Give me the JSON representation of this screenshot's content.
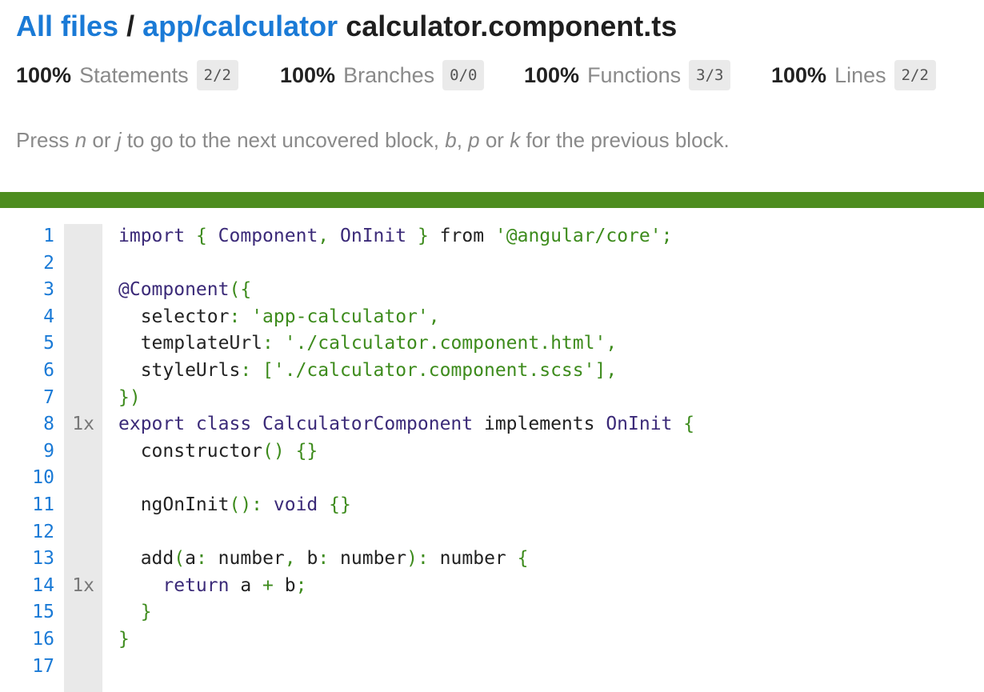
{
  "breadcrumb": {
    "all_files": "All files",
    "separator": "/",
    "folder": "app/calculator",
    "file": "calculator.component.ts"
  },
  "stats": [
    {
      "pct": "100%",
      "name": "Statements",
      "frac": "2/2"
    },
    {
      "pct": "100%",
      "name": "Branches",
      "frac": "0/0"
    },
    {
      "pct": "100%",
      "name": "Functions",
      "frac": "3/3"
    },
    {
      "pct": "100%",
      "name": "Lines",
      "frac": "2/2"
    }
  ],
  "hint": {
    "t1": "Press ",
    "k1": "n",
    "t2": " or ",
    "k2": "j",
    "t3": " to go to the next uncovered block, ",
    "k3": "b",
    "t4": ", ",
    "k4": "p",
    "t5": " or ",
    "k5": "k",
    "t6": " for the previous block."
  },
  "colors": {
    "status_bar": "#4d8d1f",
    "link": "#1a7ad6",
    "gutter": "#e9e9e9"
  },
  "code": {
    "lines": [
      {
        "n": "1",
        "hits": "",
        "tokens": [
          [
            "kw",
            "import"
          ],
          [
            "tx",
            " "
          ],
          [
            "pn",
            "{"
          ],
          [
            "tx",
            " "
          ],
          [
            "ty",
            "Component"
          ],
          [
            "pn",
            ","
          ],
          [
            "tx",
            " "
          ],
          [
            "ty",
            "OnInit"
          ],
          [
            "tx",
            " "
          ],
          [
            "pn",
            "}"
          ],
          [
            "tx",
            " from "
          ],
          [
            "str",
            "'@angular/core'"
          ],
          [
            "pn",
            ";"
          ]
        ]
      },
      {
        "n": "2",
        "hits": "",
        "tokens": []
      },
      {
        "n": "3",
        "hits": "",
        "tokens": [
          [
            "kw",
            "@Component"
          ],
          [
            "pn",
            "({"
          ]
        ]
      },
      {
        "n": "4",
        "hits": "",
        "tokens": [
          [
            "tx",
            "  selector"
          ],
          [
            "pn",
            ":"
          ],
          [
            "tx",
            " "
          ],
          [
            "str",
            "'app-calculator'"
          ],
          [
            "pn",
            ","
          ]
        ]
      },
      {
        "n": "5",
        "hits": "",
        "tokens": [
          [
            "tx",
            "  templateUrl"
          ],
          [
            "pn",
            ":"
          ],
          [
            "tx",
            " "
          ],
          [
            "str",
            "'./calculator.component.html'"
          ],
          [
            "pn",
            ","
          ]
        ]
      },
      {
        "n": "6",
        "hits": "",
        "tokens": [
          [
            "tx",
            "  styleUrls"
          ],
          [
            "pn",
            ":"
          ],
          [
            "tx",
            " "
          ],
          [
            "str",
            "['./calculator.component.scss']"
          ],
          [
            "pn",
            ","
          ]
        ]
      },
      {
        "n": "7",
        "hits": "",
        "tokens": [
          [
            "pn",
            "})"
          ]
        ]
      },
      {
        "n": "8",
        "hits": "1x",
        "tokens": [
          [
            "kw",
            "export class"
          ],
          [
            "tx",
            " "
          ],
          [
            "ty",
            "CalculatorComponent"
          ],
          [
            "tx",
            " implements "
          ],
          [
            "ty",
            "OnInit"
          ],
          [
            "tx",
            " "
          ],
          [
            "pn",
            "{"
          ]
        ]
      },
      {
        "n": "9",
        "hits": "",
        "tokens": [
          [
            "tx",
            "  constructor"
          ],
          [
            "pn",
            "()"
          ],
          [
            "tx",
            " "
          ],
          [
            "pn",
            "{}"
          ]
        ]
      },
      {
        "n": "10",
        "hits": "",
        "tokens": []
      },
      {
        "n": "11",
        "hits": "",
        "tokens": [
          [
            "tx",
            "  ngOnInit"
          ],
          [
            "pn",
            "():"
          ],
          [
            "tx",
            " "
          ],
          [
            "kw",
            "void"
          ],
          [
            "tx",
            " "
          ],
          [
            "pn",
            "{}"
          ]
        ]
      },
      {
        "n": "12",
        "hits": "",
        "tokens": []
      },
      {
        "n": "13",
        "hits": "",
        "tokens": [
          [
            "tx",
            "  add"
          ],
          [
            "pn",
            "("
          ],
          [
            "tx",
            "a"
          ],
          [
            "pn",
            ":"
          ],
          [
            "tx",
            " number"
          ],
          [
            "pn",
            ","
          ],
          [
            "tx",
            " b"
          ],
          [
            "pn",
            ":"
          ],
          [
            "tx",
            " number"
          ],
          [
            "pn",
            "):"
          ],
          [
            "tx",
            " number "
          ],
          [
            "pn",
            "{"
          ]
        ]
      },
      {
        "n": "14",
        "hits": "1x",
        "tokens": [
          [
            "tx",
            "    "
          ],
          [
            "kw",
            "return"
          ],
          [
            "tx",
            " a "
          ],
          [
            "pn",
            "+"
          ],
          [
            "tx",
            " b"
          ],
          [
            "pn",
            ";"
          ]
        ]
      },
      {
        "n": "15",
        "hits": "",
        "tokens": [
          [
            "pn",
            "  }"
          ]
        ]
      },
      {
        "n": "16",
        "hits": "",
        "tokens": [
          [
            "pn",
            "}"
          ]
        ]
      },
      {
        "n": "17",
        "hits": "",
        "tokens": []
      }
    ]
  }
}
